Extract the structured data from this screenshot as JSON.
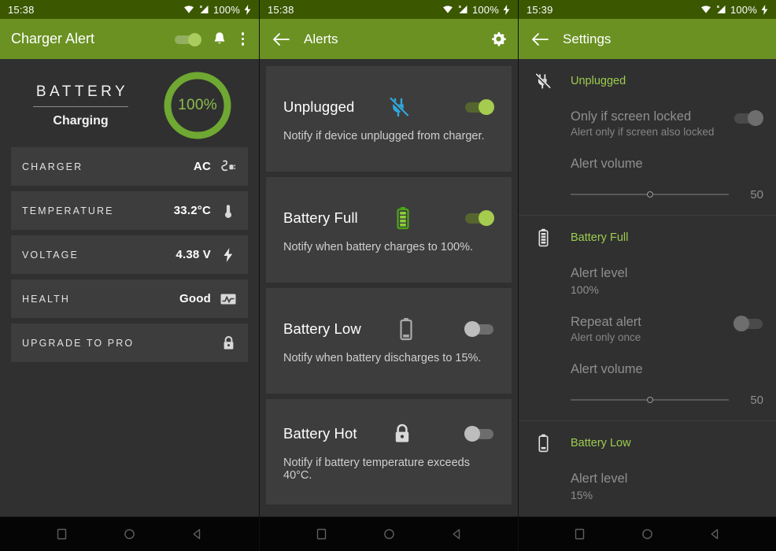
{
  "theme": {
    "status_bar_bg": "#3b5800",
    "app_bar_bg": "#6a9122",
    "page_bg": "#303030",
    "card_bg": "#3d3d3d",
    "accent_green": "#9ccc50",
    "ring_green": "#6fa832",
    "toggle_on": "#a5cc4f",
    "toggle_off": "#bdbdbd",
    "nav_bg": "#050505"
  },
  "screens": [
    {
      "status": {
        "clock": "15:38",
        "battery_pct": "100%",
        "icons": [
          "wifi-icon",
          "signal-icon",
          "charging-bolt-icon"
        ]
      },
      "appbar": {
        "title": "Charger Alert",
        "switch_on": true,
        "actions": [
          "bell-icon",
          "overflow-menu-icon"
        ]
      },
      "hero": {
        "title": "BATTERY",
        "subtitle": "Charging",
        "ring_value": "100%",
        "ring_percent": 100
      },
      "rows": [
        {
          "label": "CHARGER",
          "value": "AC",
          "icon": "plug-icon"
        },
        {
          "label": "TEMPERATURE",
          "value": "33.2°C",
          "icon": "thermometer-icon"
        },
        {
          "label": "VOLTAGE",
          "value": "4.38 V",
          "icon": "bolt-icon"
        },
        {
          "label": "HEALTH",
          "value": "Good",
          "icon": "pulse-icon"
        },
        {
          "label": "UPGRADE TO PRO",
          "value": "",
          "icon": "lock-icon"
        }
      ]
    },
    {
      "status": {
        "clock": "15:38",
        "battery_pct": "100%"
      },
      "appbar": {
        "title": "Alerts",
        "back": "back-arrow-icon",
        "actions": [
          "gear-icon"
        ]
      },
      "cards": [
        {
          "title": "Unplugged",
          "icon": "plug-off-icon",
          "desc": "Notify if device unplugged from charger.",
          "enabled": true
        },
        {
          "title": "Battery Full",
          "icon": "battery-full-icon",
          "desc": "Notify when battery charges to 100%.",
          "enabled": true
        },
        {
          "title": "Battery Low",
          "icon": "battery-low-icon",
          "desc": "Notify when battery discharges to 15%.",
          "enabled": false
        },
        {
          "title": "Battery Hot",
          "icon": "lock-icon",
          "desc": "Notify if battery temperature exceeds 40°C.",
          "enabled": false
        }
      ]
    },
    {
      "status": {
        "clock": "15:39",
        "battery_pct": "100%"
      },
      "appbar": {
        "title": "Settings",
        "back": "back-arrow-icon"
      },
      "groups": [
        {
          "title": "Unplugged",
          "icon": "plug-off-icon",
          "rows": [
            {
              "type": "toggle",
              "main": "Only if screen locked",
              "sub": "Alert only if screen also locked",
              "on": true
            },
            {
              "type": "slider",
              "main": "Alert volume",
              "value": "50",
              "percent": 50
            }
          ]
        },
        {
          "title": "Battery Full",
          "icon": "battery-full-outline-icon",
          "rows": [
            {
              "type": "value",
              "main": "Alert level",
              "sub": "100%"
            },
            {
              "type": "toggle",
              "main": "Repeat alert",
              "sub": "Alert only once",
              "on": false
            },
            {
              "type": "slider",
              "main": "Alert volume",
              "value": "50",
              "percent": 50
            }
          ]
        },
        {
          "title": "Battery Low",
          "icon": "battery-low-outline-icon",
          "rows": [
            {
              "type": "value",
              "main": "Alert level",
              "sub": "15%"
            }
          ]
        }
      ]
    }
  ],
  "navbar": {
    "buttons": [
      "recents-square-icon",
      "home-circle-icon",
      "back-triangle-icon"
    ]
  }
}
